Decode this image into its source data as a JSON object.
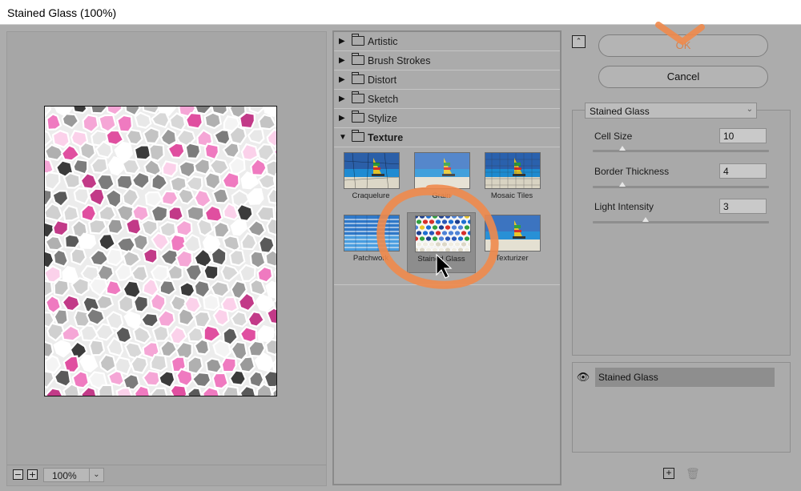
{
  "window": {
    "title": "Stained Glass (100%)"
  },
  "preview": {
    "zoom_out": "−",
    "zoom_in": "+",
    "zoom_value": "100%"
  },
  "gallery": {
    "categories": [
      {
        "label": "Artistic",
        "expanded": false
      },
      {
        "label": "Brush Strokes",
        "expanded": false
      },
      {
        "label": "Distort",
        "expanded": false
      },
      {
        "label": "Sketch",
        "expanded": false
      },
      {
        "label": "Stylize",
        "expanded": false
      },
      {
        "label": "Texture",
        "expanded": true
      }
    ],
    "texture_filters": [
      {
        "label": "Craquelure"
      },
      {
        "label": "Grain"
      },
      {
        "label": "Mosaic Tiles"
      },
      {
        "label": "Patchwork"
      },
      {
        "label": "Stained Glass",
        "selected": true
      },
      {
        "label": "Texturizer"
      }
    ]
  },
  "actions": {
    "ok": "OK",
    "cancel": "Cancel"
  },
  "settings": {
    "filter": "Stained Glass",
    "params": [
      {
        "label": "Cell Size",
        "value": "10",
        "level": 0.17
      },
      {
        "label": "Border Thickness",
        "value": "4",
        "level": 0.17
      },
      {
        "label": "Light Intensity",
        "value": "3",
        "level": 0.3
      }
    ]
  },
  "layers": [
    {
      "name": "Stained Glass",
      "visible": true
    }
  ],
  "colors": {
    "accent_annotation": "#f08a4b",
    "ok_text": "#d97f4a"
  }
}
